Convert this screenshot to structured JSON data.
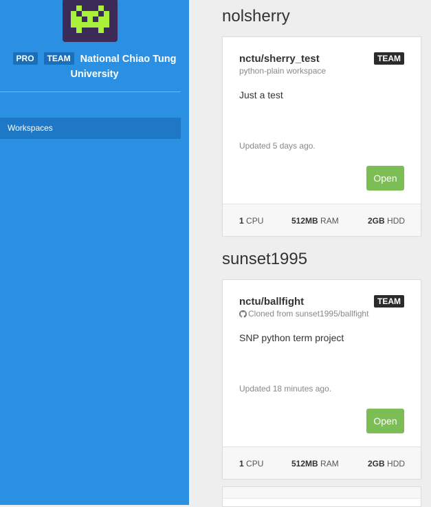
{
  "sidebar": {
    "badges": {
      "pro": "PRO",
      "team": "TEAM"
    },
    "org_name_line1": "National Chiao Tung",
    "org_name_line2": "University",
    "nav_items": [
      {
        "label": "Workspaces"
      }
    ]
  },
  "colors": {
    "sidebar_bg": "#2b8fe2",
    "open_button": "#7dbd56",
    "team_badge": "#2b2b2b",
    "avatar_bg": "#3d2b57",
    "avatar_fg": "#a8f03a"
  },
  "groups": [
    {
      "user": "nolsherry",
      "workspace": {
        "title": "nctu/sherry_test",
        "badge": "TEAM",
        "subtitle": "python-plain workspace",
        "subtitle_icon": "",
        "description": "Just a test",
        "updated": "Updated 5 days ago.",
        "open_label": "Open",
        "specs": {
          "cpu_value": "1",
          "cpu_unit": "CPU",
          "ram_value": "512MB",
          "ram_unit": "RAM",
          "hdd_value": "2GB",
          "hdd_unit": "HDD"
        }
      }
    },
    {
      "user": "sunset1995",
      "workspace": {
        "title": "nctu/ballfight",
        "badge": "TEAM",
        "subtitle": "Cloned from sunset1995/ballfight",
        "subtitle_icon": "github-icon",
        "description": "SNP python term project",
        "updated": "Updated 18 minutes ago.",
        "open_label": "Open",
        "specs": {
          "cpu_value": "1",
          "cpu_unit": "CPU",
          "ram_value": "512MB",
          "ram_unit": "RAM",
          "hdd_value": "2GB",
          "hdd_unit": "HDD"
        }
      }
    }
  ]
}
